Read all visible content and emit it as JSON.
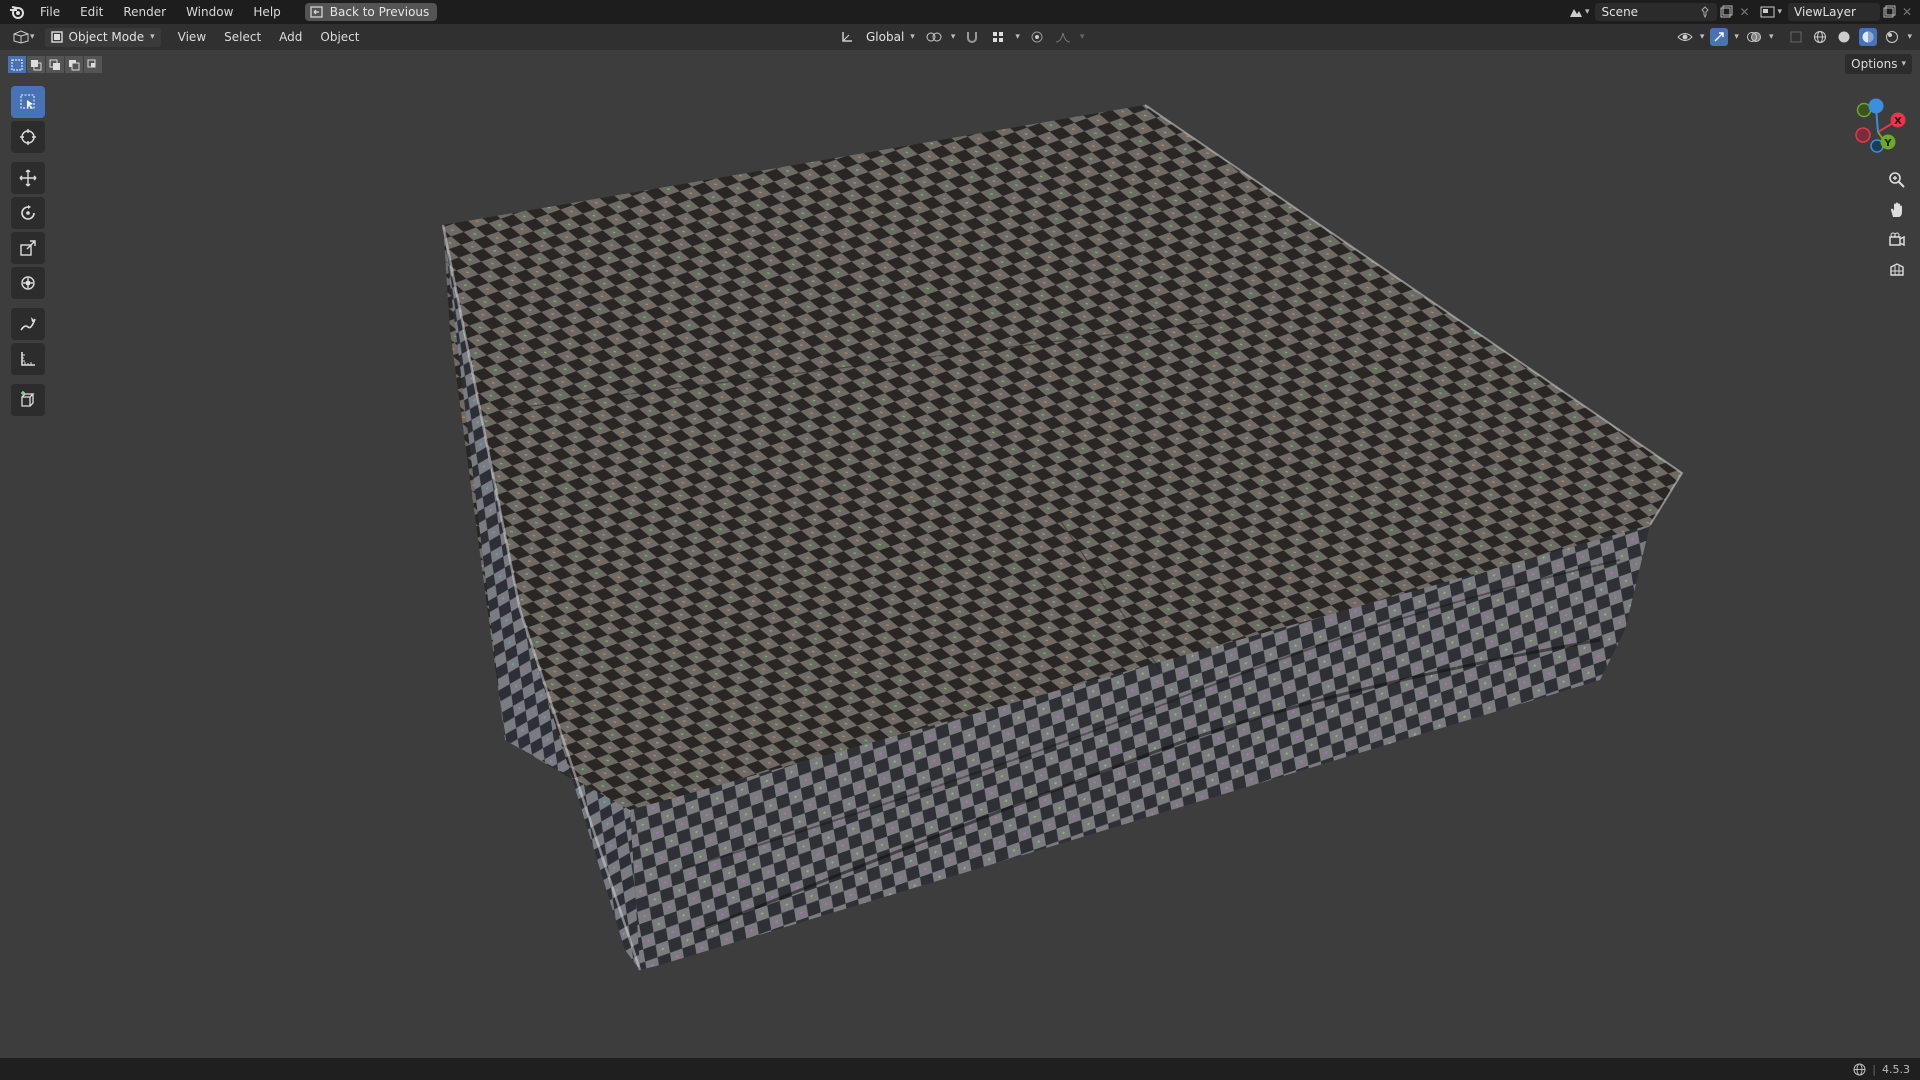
{
  "menubar": {
    "items": [
      "File",
      "Edit",
      "Render",
      "Window",
      "Help"
    ],
    "back_button": "Back to Previous"
  },
  "scene": {
    "name": "Scene"
  },
  "view_layer": {
    "name": "ViewLayer"
  },
  "header": {
    "mode": "Object Mode",
    "menus": [
      "View",
      "Select",
      "Add",
      "Object"
    ],
    "transform_orientation": "Global"
  },
  "viewport": {
    "options_label": "Options"
  },
  "gizmo": {
    "x_label": "X",
    "y_label": "Y"
  },
  "status": {
    "version": "4.5.3"
  },
  "colors": {
    "accent": "#4772b3",
    "background": "#3d3d3d",
    "topbar": "#1d1d1d",
    "axis_x": "#e8364f",
    "axis_y": "#6ea826",
    "axis_z": "#3a8fe0"
  },
  "icons": {
    "blender_logo": "blender-logo-icon",
    "tools": [
      "select-box-icon",
      "cursor-icon",
      "move-icon",
      "rotate-icon",
      "scale-icon",
      "transform-icon",
      "annotate-icon",
      "measure-icon",
      "add-cube-icon"
    ],
    "nav": [
      "zoom-icon",
      "pan-hand-icon",
      "camera-icon",
      "grid-view-icon"
    ]
  }
}
